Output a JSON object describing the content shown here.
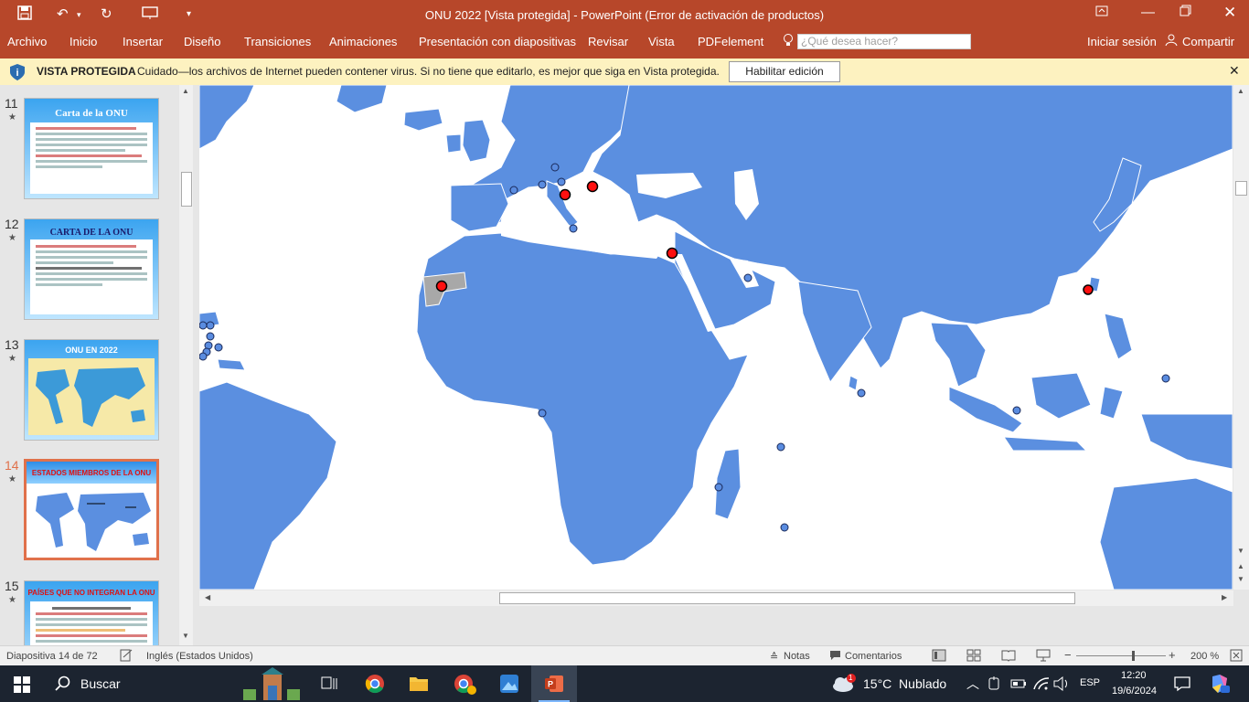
{
  "app": {
    "window_title": "ONU 2022 [Vista protegida] - PowerPoint (Error de activación de productos)",
    "colors": {
      "brand": "#b7472a",
      "map_land": "#5b8fe0",
      "map_sea": "#ffffff",
      "dot_red": "#ff1010",
      "dot_blue": "#5a8ce0",
      "protected_bar": "#fdf2c0"
    }
  },
  "quick_access": {
    "icons": [
      "save-icon",
      "undo-icon",
      "redo-icon",
      "present-icon",
      "customize-icon"
    ]
  },
  "ribbon": {
    "tabs": [
      "Archivo",
      "Inicio",
      "Insertar",
      "Diseño",
      "Transiciones",
      "Animaciones",
      "Presentación con diapositivas",
      "Revisar",
      "Vista",
      "PDFelement"
    ],
    "tell_me_placeholder": "¿Qué desea hacer?",
    "signin": "Iniciar sesión",
    "share": "Compartir"
  },
  "protected_view": {
    "title": "VISTA PROTEGIDA",
    "message": "Cuidado—los archivos de Internet pueden contener virus. Si no tiene que editarlo, es mejor que siga en Vista protegida.",
    "enable_button": "Habilitar edición"
  },
  "thumbnails": [
    {
      "number": "11",
      "title": "Carta de la ONU"
    },
    {
      "number": "12",
      "title": "CARTA DE LA ONU"
    },
    {
      "number": "13",
      "title": "ONU EN 2022"
    },
    {
      "number": "14",
      "title": "ESTADOS MIEMBROS DE LA ONU"
    },
    {
      "number": "15",
      "title": "PAÍSES QUE NO INTEGRAN LA ONU"
    }
  ],
  "status": {
    "slide": "Diapositiva 14 de 72",
    "language": "Inglés (Estados Unidos)",
    "notes": "Notas",
    "comments": "Comentarios",
    "zoom": "200 %"
  },
  "taskbar": {
    "search": "Buscar",
    "weather": "15°C  Nublado",
    "weather_badge": "1",
    "lang": "ESP",
    "time": "12:20",
    "date": "19/6/2024"
  }
}
